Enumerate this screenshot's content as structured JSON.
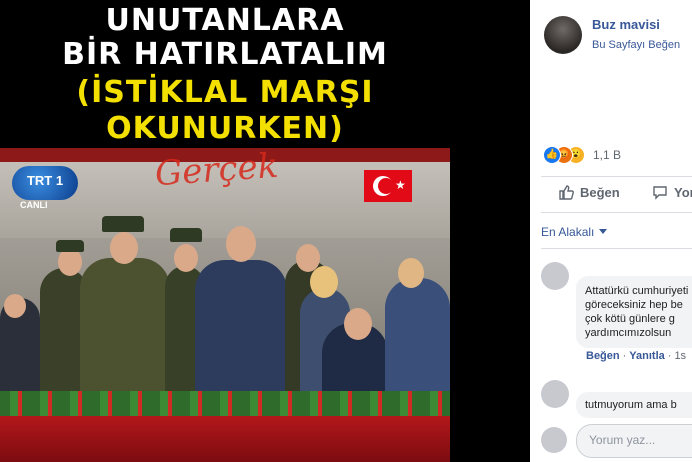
{
  "photo": {
    "headline_lines": [
      "UNUTANLARA",
      "BİR HATIRLATALIM",
      "(İSTİKLAL MARŞI",
      "OKUNURKEN)"
    ],
    "tv_logo": "TRT 1",
    "tv_logo_sub": "CANLI",
    "watermark": "Gerçek"
  },
  "post": {
    "page_name": "Buz mavisi",
    "page_action": "Bu Sayfayı Beğen",
    "reaction_icons": [
      "like-reaction-icon",
      "angry-reaction-icon",
      "wow-reaction-icon"
    ],
    "reaction_count": "1,1 B",
    "like_label": "Beğen",
    "comment_label": "Yorum Yap",
    "sort_label": "En Alakalı"
  },
  "comments": [
    {
      "lines": [
        "Attatürkü cumhuriyeti",
        "göreceksiniz hep be",
        "çok kötü günlere g",
        "yardımcımızolsun"
      ],
      "like": "Beğen",
      "reply": "Yanıtla",
      "time": "1s"
    },
    {
      "lines": [
        "tutmuyorum ama b"
      ]
    }
  ],
  "composer": {
    "placeholder": "Yorum yaz..."
  },
  "colors": {
    "brand_link": "#385898",
    "muted": "#606770",
    "headline_white": "#ffffff",
    "headline_yellow": "#f4e000",
    "flag_red": "#e30a17"
  }
}
